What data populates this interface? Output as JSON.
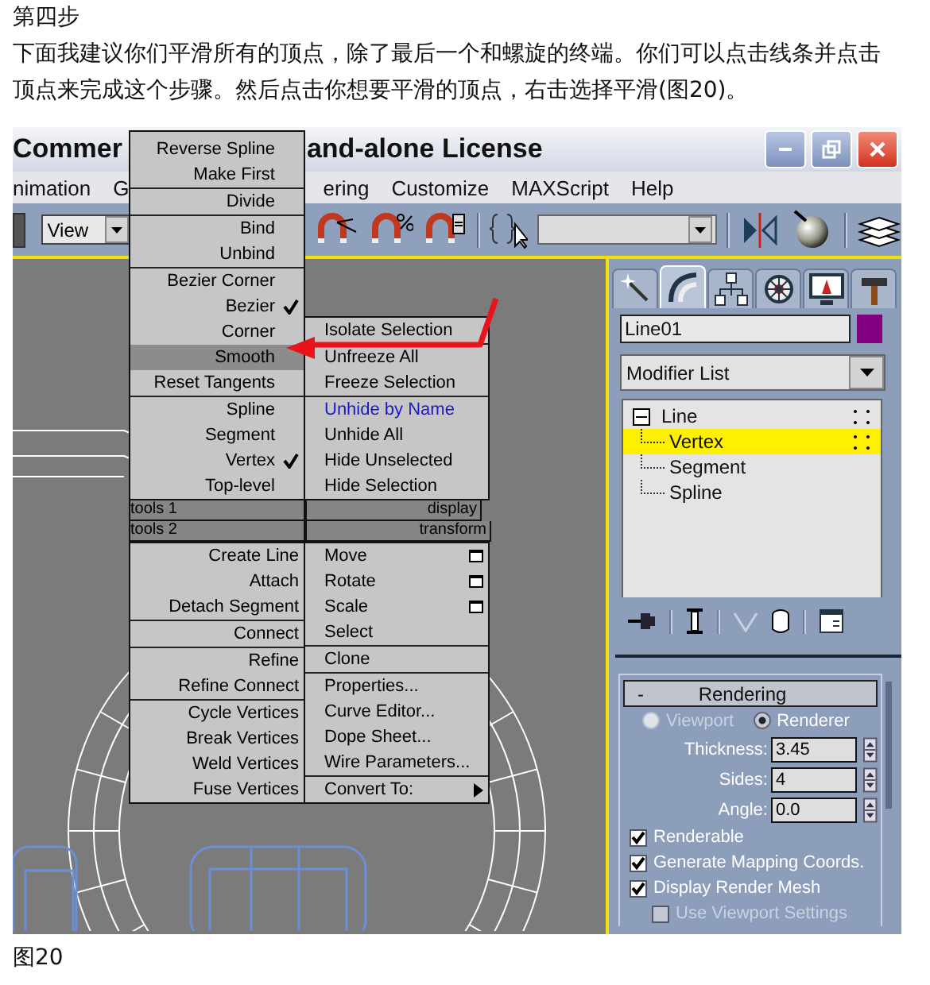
{
  "article": {
    "heading": "第四步",
    "paragraph": "下面我建议你们平滑所有的顶点，除了最后一个和螺旋的终端。你们可以点击线条并点击顶点来完成这个步骤。然后点击你想要平滑的顶点，右击选择平滑(图20)。",
    "caption": "图20"
  },
  "app": {
    "title_left": "Commer",
    "title_right": "and-alone License",
    "menu": [
      "nimation",
      "G",
      "ering",
      "Customize",
      "MAXScript",
      "Help"
    ],
    "toolbar": {
      "view_dropdown": "View"
    },
    "quad_menu": {
      "upper_left": {
        "groups": [
          {
            "items": [
              {
                "label": "Reverse Spline",
                "checked": false,
                "selected": false
              },
              {
                "label": "Make First",
                "checked": false,
                "selected": false
              }
            ]
          },
          {
            "items": [
              {
                "label": "Divide",
                "checked": false,
                "selected": false
              }
            ]
          },
          {
            "items": [
              {
                "label": "Bind",
                "checked": false,
                "selected": false
              },
              {
                "label": "Unbind",
                "checked": false,
                "selected": false
              }
            ]
          },
          {
            "items": [
              {
                "label": "Bezier Corner",
                "checked": false,
                "selected": false
              },
              {
                "label": "Bezier",
                "checked": true,
                "selected": false
              },
              {
                "label": "Corner",
                "checked": false,
                "selected": false
              },
              {
                "label": "Smooth",
                "checked": false,
                "selected": true
              },
              {
                "label": "Reset Tangents",
                "checked": false,
                "selected": false
              }
            ]
          },
          {
            "items": [
              {
                "label": "Spline",
                "checked": false,
                "selected": false
              },
              {
                "label": "Segment",
                "checked": false,
                "selected": false
              },
              {
                "label": "Vertex",
                "checked": true,
                "selected": false
              },
              {
                "label": "Top-level",
                "checked": false,
                "selected": false
              }
            ]
          }
        ]
      },
      "upper_right": {
        "groups": [
          {
            "items": [
              {
                "label": "Isolate Selection",
                "recent": false
              }
            ]
          },
          {
            "items": [
              {
                "label": "Unfreeze All",
                "recent": false
              },
              {
                "label": "Freeze Selection",
                "recent": false
              }
            ]
          },
          {
            "items": [
              {
                "label": "Unhide by Name",
                "recent": true
              },
              {
                "label": "Unhide All",
                "recent": false
              },
              {
                "label": "Hide Unselected",
                "recent": false
              },
              {
                "label": "Hide Selection",
                "recent": false
              }
            ]
          }
        ]
      },
      "header_1": {
        "left": "tools 1",
        "right": "display"
      },
      "header_2": {
        "left": "tools 2",
        "right": "transform"
      },
      "lower_left": {
        "groups": [
          {
            "items": [
              {
                "label": "Create Line"
              },
              {
                "label": "Attach"
              },
              {
                "label": "Detach Segment"
              }
            ]
          },
          {
            "items": [
              {
                "label": "Connect"
              }
            ]
          },
          {
            "items": [
              {
                "label": "Refine"
              },
              {
                "label": "Refine Connect"
              }
            ]
          },
          {
            "items": [
              {
                "label": "Cycle Vertices"
              },
              {
                "label": "Break Vertices"
              },
              {
                "label": "Weld Vertices"
              },
              {
                "label": "Fuse Vertices"
              }
            ]
          }
        ]
      },
      "lower_right": {
        "groups": [
          {
            "items": [
              {
                "label": "Move",
                "kind": "options"
              },
              {
                "label": "Rotate",
                "kind": "options"
              },
              {
                "label": "Scale",
                "kind": "options"
              },
              {
                "label": "Select",
                "kind": "plain"
              }
            ]
          },
          {
            "items": [
              {
                "label": "Clone",
                "kind": "plain"
              }
            ]
          },
          {
            "items": [
              {
                "label": "Properties...",
                "kind": "plain"
              },
              {
                "label": "Curve Editor...",
                "kind": "plain"
              },
              {
                "label": "Dope Sheet...",
                "kind": "plain"
              },
              {
                "label": "Wire Parameters...",
                "kind": "plain"
              }
            ]
          },
          {
            "items": [
              {
                "label": "Convert To:",
                "kind": "submenu"
              }
            ]
          }
        ]
      }
    },
    "panel": {
      "tabs": [
        {
          "kind": "wand",
          "selected": false
        },
        {
          "kind": "arc",
          "selected": true
        },
        {
          "kind": "hierarchy",
          "selected": false
        },
        {
          "kind": "wheel",
          "selected": false
        },
        {
          "kind": "monitor",
          "selected": false
        },
        {
          "kind": "hammer",
          "selected": false
        }
      ],
      "name_field": {
        "value": "Line01",
        "color": "#800080"
      },
      "modifier_dropdown": "Modifier List",
      "stack": [
        {
          "label": "Line",
          "expanded": true,
          "selected": false,
          "children": [
            {
              "label": "Vertex",
              "selected": true
            },
            {
              "label": "Segment",
              "selected": false
            },
            {
              "label": "Spline",
              "selected": false
            }
          ]
        }
      ],
      "rollout": {
        "toggle": "-",
        "title": "Rendering",
        "radios": [
          {
            "label": "Viewport",
            "selected": false,
            "disabled": true
          },
          {
            "label": "Renderer",
            "selected": true,
            "disabled": false
          }
        ],
        "spinners": [
          {
            "label": "Thickness:",
            "value": "3.45"
          },
          {
            "label": "Sides:",
            "value": "4"
          },
          {
            "label": "Angle:",
            "value": "0.0"
          }
        ],
        "checkboxes": [
          {
            "label": "Renderable",
            "checked": true,
            "disabled": false
          },
          {
            "label": "Generate Mapping Coords.",
            "checked": true,
            "disabled": false
          },
          {
            "label": "Display Render Mesh",
            "checked": true,
            "disabled": false
          },
          {
            "label": "Use Viewport Settings",
            "checked": false,
            "disabled": true
          }
        ]
      }
    }
  }
}
